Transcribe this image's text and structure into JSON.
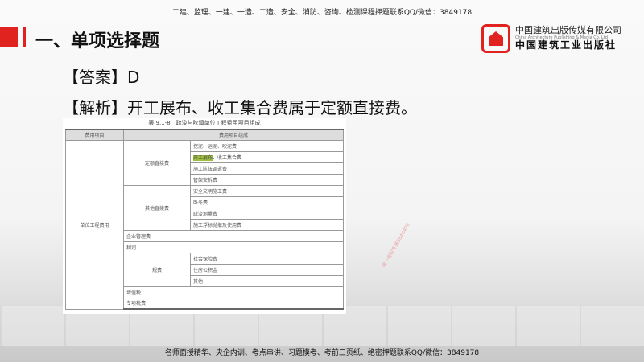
{
  "header_banner": "二建、监理、一建、一造、二造、安全、消防、咨询、检测课程押题联系QQ/微信：3849178",
  "footer_banner": "名师面授精华、央企内训、考点串讲、习题模考、考前三页纸、绝密押题联系QQ/微信：3849178",
  "title": "一、单项选择题",
  "answer": "【答案】D",
  "analysis": "【解析】开工展布、收工集合费属于定额直接费。",
  "logo": {
    "cn": "中国建筑出版传媒有限公司",
    "en": "China Architecture Publishing & Media Co.,Ltd",
    "sub": "中国建筑工业出版社"
  },
  "table": {
    "caption": "表 9.1-8　疏浚与吹填单位工程费用项目组成",
    "headers": [
      "费用项目",
      "费用项目组成"
    ],
    "root": "单位工程费用",
    "g1": "定额直接费",
    "g1_items": [
      "挖泥、运泥、吹泥费",
      "开工展布",
      "、收工集合费",
      "施工队伍调遣费",
      "管架安拆费"
    ],
    "g2": "其他直接费",
    "g2_items": [
      "安全文明施工费",
      "卧冬费",
      "疏浚测量费",
      "施工浮标抛撤及使用费"
    ],
    "mgmt": "企业管理费",
    "profit": "利润",
    "g3": "规费",
    "g3_items": [
      "社会保险费",
      "住房公积金",
      "其他"
    ],
    "vat": "增值税",
    "special": "专项税费"
  },
  "watermark": "唯一授权专属5846478"
}
